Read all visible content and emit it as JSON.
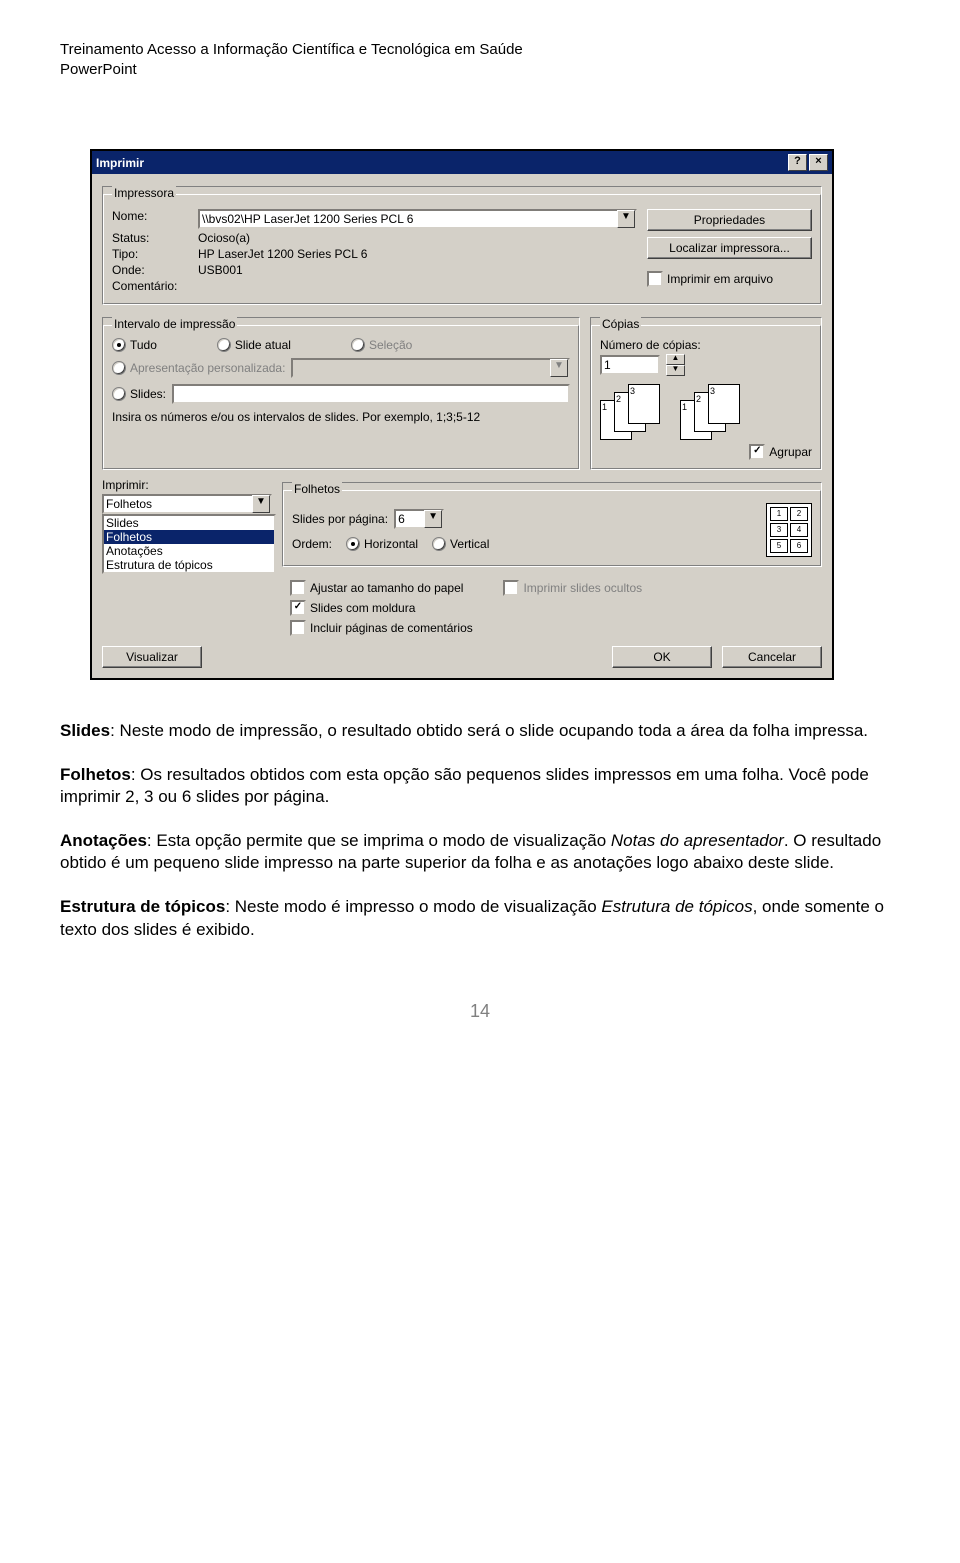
{
  "header": {
    "line1": "Treinamento Acesso a Informação Científica e Tecnológica em Saúde",
    "line2": "PowerPoint"
  },
  "dialog": {
    "title": "Imprimir",
    "help_btn": "?",
    "close_btn": "×",
    "impressora": {
      "legend": "Impressora",
      "nome_label": "Nome:",
      "nome_value": "\\\\bvs02\\HP LaserJet 1200 Series PCL 6",
      "status_label": "Status:",
      "status_value": "Ocioso(a)",
      "tipo_label": "Tipo:",
      "tipo_value": "HP LaserJet 1200 Series PCL 6",
      "onde_label": "Onde:",
      "onde_value": "USB001",
      "comentario_label": "Comentário:",
      "btn_propriedades": "Propriedades",
      "btn_localizar": "Localizar impressora...",
      "chk_arquivo": "Imprimir em arquivo"
    },
    "intervalo": {
      "legend": "Intervalo de impressão",
      "tudo": "Tudo",
      "slide_atual": "Slide atual",
      "selecao": "Seleção",
      "apresentacao": "Apresentação personalizada:",
      "slides": "Slides:",
      "nota": "Insira os números e/ou os intervalos de slides. Por exemplo, 1;3;5-12"
    },
    "copias": {
      "legend": "Cópias",
      "numero_label": "Número de cópias:",
      "numero_value": "1",
      "agrupar": "Agrupar"
    },
    "imprimir": {
      "label": "Imprimir:",
      "selected": "Folhetos",
      "options": [
        "Slides",
        "Folhetos",
        "Anotações",
        "Estrutura de tópicos"
      ]
    },
    "folhetos": {
      "legend": "Folhetos",
      "slides_por_pagina": "Slides por página:",
      "spp_value": "6",
      "ordem": "Ordem:",
      "horizontal": "Horizontal",
      "vertical": "Vertical",
      "chk_ajustar": "Ajustar ao tamanho do papel",
      "chk_ocultos": "Imprimir slides ocultos",
      "chk_moldura": "Slides com moldura",
      "chk_comentarios": "Incluir páginas de comentários"
    },
    "buttons": {
      "visualizar": "Visualizar",
      "ok": "OK",
      "cancelar": "Cancelar"
    }
  },
  "body": {
    "p1_b": "Slides",
    "p1": ": Neste modo de impressão, o resultado obtido será o slide ocupando toda a área da folha impressa.",
    "p2_b": "Folhetos",
    "p2": ": Os resultados obtidos com esta opção são pequenos slides impressos em uma folha. Você pode imprimir 2, 3 ou 6 slides por página.",
    "p3_b": "Anotações",
    "p3a": ": Esta opção permite que se imprima o modo de visualização ",
    "p3_i": "Notas do apresentador",
    "p3b": ". O resultado obtido é um pequeno slide impresso na parte superior da folha e as anotações logo abaixo deste slide.",
    "p4_b": "Estrutura de tópicos",
    "p4a": ": Neste modo é impresso o modo de visualização ",
    "p4_i": "Estrutura de tópicos",
    "p4b": ", onde somente o texto dos slides é exibido."
  },
  "page_number": "14"
}
